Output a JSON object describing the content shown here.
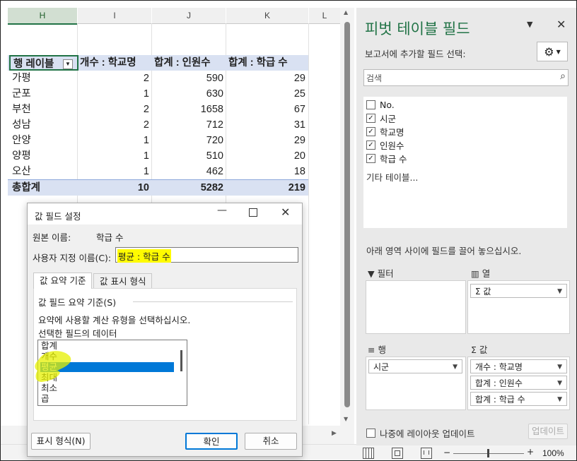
{
  "sheet": {
    "columns": [
      "H",
      "I",
      "J",
      "K",
      "L"
    ],
    "pivot": {
      "headers": [
        "행 레이블",
        "개수 : 학교명",
        "합계 : 인원수",
        "합계 : 학급 수"
      ],
      "rows": [
        [
          "가평",
          "2",
          "590",
          "29"
        ],
        [
          "군포",
          "1",
          "630",
          "25"
        ],
        [
          "부천",
          "2",
          "1658",
          "67"
        ],
        [
          "성남",
          "2",
          "712",
          "31"
        ],
        [
          "안양",
          "1",
          "720",
          "29"
        ],
        [
          "양평",
          "1",
          "510",
          "20"
        ],
        [
          "오산",
          "1",
          "462",
          "18"
        ]
      ],
      "total": [
        "총합계",
        "10",
        "5282",
        "219"
      ]
    }
  },
  "pane": {
    "title": "피벗 테이블 필드",
    "choose_label": "보고서에 추가할 필드 선택:",
    "search_placeholder": "검색",
    "fields": [
      {
        "label": "No.",
        "checked": false
      },
      {
        "label": "시군",
        "checked": true
      },
      {
        "label": "학교명",
        "checked": true
      },
      {
        "label": "인원수",
        "checked": true
      },
      {
        "label": "학급 수",
        "checked": true
      }
    ],
    "more_tables": "기타 테이블...",
    "drag_hint": "아래 영역 사이에 필드를 끌어 놓으십시오.",
    "areas": {
      "filter_label": "필터",
      "columns_label": "열",
      "rows_label": "행",
      "values_label": "값",
      "columns_items": [
        "Σ 값"
      ],
      "rows_items": [
        "시군"
      ],
      "values_items": [
        "개수 : 학교명",
        "합계 : 인원수",
        "합계 : 학급 수"
      ]
    },
    "defer_label": "나중에 레이아웃 업데이트",
    "update_label": "업데이트"
  },
  "dialog": {
    "title": "값 필드 설정",
    "source_label": "원본 이름:",
    "source_value": "학급 수",
    "custom_name_label": "사용자 지정 이름(C):",
    "custom_name_value": "평균 : 학급 수",
    "tabs": [
      "값 요약 기준",
      "값 표시 형식"
    ],
    "section_title": "값 필드 요약 기준(S)",
    "instruction": "요약에 사용할 계산 유형을 선택하십시오.",
    "data_label": "선택한 필드의 데이터",
    "functions": [
      "합계",
      "개수",
      "평균",
      "최대",
      "최소",
      "곱"
    ],
    "selected_function": "평균",
    "number_format_label": "표시 형식(N)",
    "ok_label": "확인",
    "cancel_label": "취소"
  },
  "status": {
    "zoom": "100%",
    "zoom_minus": "−",
    "zoom_plus": "+"
  },
  "colors": {
    "accent": "#217346",
    "pivot_header": "#d9e1f2",
    "selection": "#0078d7",
    "highlight": "#fffb00"
  }
}
